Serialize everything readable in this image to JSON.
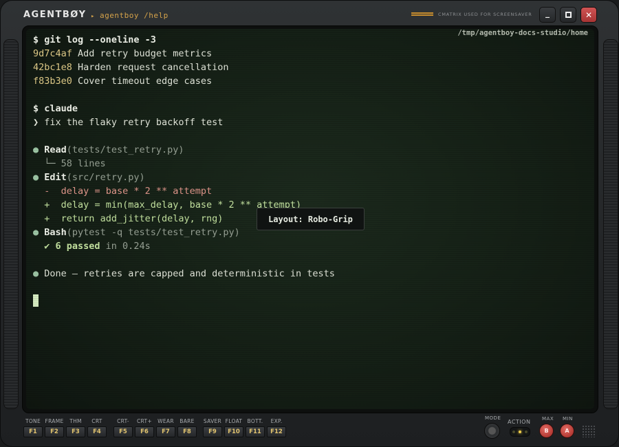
{
  "window": {
    "brand": "AGENTBØY",
    "path": "agentboy /help",
    "saver_label": "CMATRIX USED FOR SCREENSAVER",
    "buttons": {
      "minimize": "_",
      "maximize": "□",
      "close": "✕"
    }
  },
  "terminal": {
    "cwd": "/tmp/agentboy-docs-studio/home",
    "prompt": "$",
    "git_command": "git log --oneline -3",
    "commits": [
      {
        "hash": "9d7c4af",
        "message": "Add retry budget metrics"
      },
      {
        "hash": "42bc1e8",
        "message": "Harden request cancellation"
      },
      {
        "hash": "f83b3e0",
        "message": "Cover timeout edge cases"
      }
    ],
    "claude_command": "claude",
    "user_prompt_marker": "❯",
    "user_prompt": "fix the flaky retry backoff test",
    "bullet": "●",
    "read_tool": "Read",
    "read_arg": "(tests/test_retry.py)",
    "read_result": "└─ 58 lines",
    "edit_tool": "Edit",
    "edit_arg": "(src/retry.py)",
    "diff": [
      {
        "sign": "-",
        "text": "delay = base * 2 ** attempt"
      },
      {
        "sign": "+",
        "text": "delay = min(max_delay, base * 2 ** attempt)"
      },
      {
        "sign": "+",
        "text": "return add_jitter(delay, rng)"
      }
    ],
    "bash_tool": "Bash",
    "bash_arg": "(pytest -q tests/test_retry.py)",
    "test_result": "✔ 6 passed",
    "test_time": " in 0.24s",
    "done_message": "Done — retries are capped and deterministic in tests"
  },
  "tooltip": "Layout: Robo-Grip",
  "function_keys": [
    {
      "label": "TONE",
      "key": "F1"
    },
    {
      "label": "FRAME",
      "key": "F2"
    },
    {
      "label": "THM",
      "key": "F3"
    },
    {
      "label": "CRT",
      "key": "F4"
    },
    {
      "label": "CRT-",
      "key": "F5"
    },
    {
      "label": "CRT+",
      "key": "F6"
    },
    {
      "label": "WEAR",
      "key": "F7"
    },
    {
      "label": "BARE",
      "key": "F8"
    },
    {
      "label": "SAVER",
      "key": "F9"
    },
    {
      "label": "FLOAT",
      "key": "F10"
    },
    {
      "label": "BOTT.",
      "key": "F11"
    },
    {
      "label": "EXP.",
      "key": "F12"
    }
  ],
  "controls": {
    "mode_label": "MODE",
    "action_label": "ACTION",
    "max_label": "MAX",
    "min_label": "MIN",
    "b_button": "B",
    "a_button": "A"
  },
  "colors": {
    "accent": "#d4a24a",
    "key_text": "#e2c46f",
    "close": "#c04444",
    "screen_bg": "#172218"
  }
}
